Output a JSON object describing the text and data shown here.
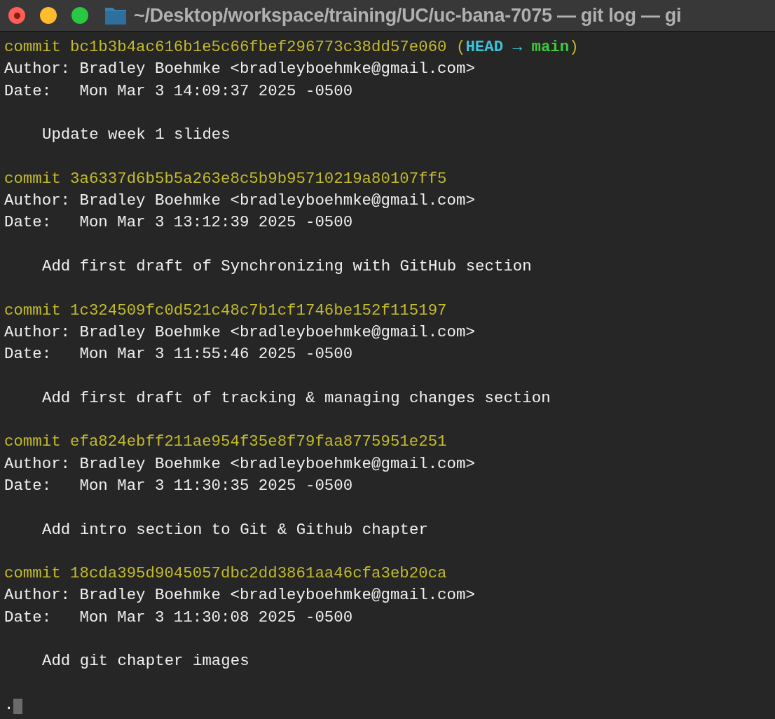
{
  "window": {
    "title": "~/Desktop/workspace/training/UC/uc-bana-7075 — git log — gi"
  },
  "commits": [
    {
      "label": "commit",
      "hash": "bc1b3b4ac616b1e5c66fbef296773c38dd57e060",
      "refs": {
        "open": "(",
        "head": "HEAD",
        "arrow": "→",
        "branch": "main",
        "close": ")"
      },
      "author": "Author: Bradley Boehmke <bradleyboehmke@gmail.com>",
      "date": "Date:   Mon Mar 3 14:09:37 2025 -0500",
      "message": "Update week 1 slides"
    },
    {
      "label": "commit",
      "hash": "3a6337d6b5b5a263e8c5b9b95710219a80107ff5",
      "author": "Author: Bradley Boehmke <bradleyboehmke@gmail.com>",
      "date": "Date:   Mon Mar 3 13:12:39 2025 -0500",
      "message": "Add first draft of Synchronizing with GitHub section"
    },
    {
      "label": "commit",
      "hash": "1c324509fc0d521c48c7b1cf1746be152f115197",
      "author": "Author: Bradley Boehmke <bradleyboehmke@gmail.com>",
      "date": "Date:   Mon Mar 3 11:55:46 2025 -0500",
      "message": "Add first draft of tracking & managing changes section"
    },
    {
      "label": "commit",
      "hash": "efa824ebff211ae954f35e8f79faa8775951e251",
      "author": "Author: Bradley Boehmke <bradleyboehmke@gmail.com>",
      "date": "Date:   Mon Mar 3 11:30:35 2025 -0500",
      "message": "Add intro section to Git & Github chapter"
    },
    {
      "label": "commit",
      "hash": "18cda395d9045057dbc2dd3861aa46cfa3eb20ca",
      "author": "Author: Bradley Boehmke <bradleyboehmke@gmail.com>",
      "date": "Date:   Mon Mar 3 11:30:08 2025 -0500",
      "message": "Add git chapter images"
    }
  ],
  "prompt": {
    "text": "."
  }
}
